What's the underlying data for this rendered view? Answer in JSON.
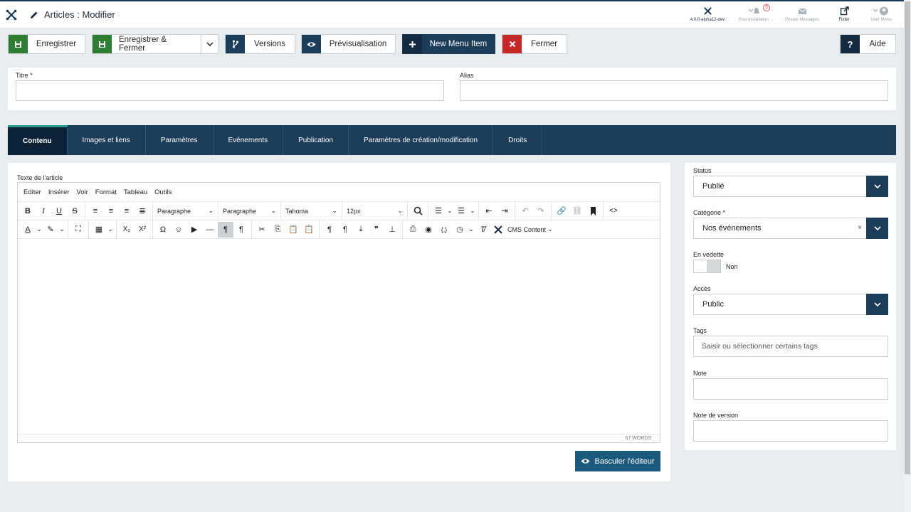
{
  "header": {
    "title": "Articles : Modifier",
    "version": "4.0.0-alpha12-dev",
    "post_installation": "Post Installation ...",
    "post_installation_count": "3",
    "private_messages": "Private Messages",
    "fixter": "Fixter",
    "user_menu": "User Menu"
  },
  "toolbar": {
    "save": "Enregistrer",
    "save_close": "Enregistrer & Fermer",
    "versions": "Versions",
    "preview": "Prévisualisation",
    "new_menu_item": "New Menu Item",
    "close": "Fermer",
    "help": "Aide"
  },
  "form": {
    "title_label": "Titre *",
    "alias_label": "Alias"
  },
  "tabs": [
    "Contenu",
    "Images et liens",
    "Paramètres",
    "Evénements",
    "Publication",
    "Paramètres de création/modification",
    "Droits"
  ],
  "editor": {
    "label": "Texte de l'article",
    "menu": [
      "Editer",
      "Insérer",
      "Voir",
      "Format",
      "Tableau",
      "Outils"
    ],
    "block_format": "Paragraphe",
    "style": "Paragraphe",
    "font": "Tahoma",
    "size": "12px",
    "cms_content": "CMS Content",
    "word_count": "67 WORDS",
    "toggle_button": "Basculer l'éditeur"
  },
  "sidebar": {
    "status_label": "Status",
    "status_value": "Publié",
    "category_label": "Catégorie *",
    "category_value": "Nos événements",
    "featured_label": "En vedette",
    "featured_value": "Non",
    "access_label": "Accès",
    "access_value": "Public",
    "tags_label": "Tags",
    "tags_placeholder": "Saisir ou sélectionner certains tags",
    "note_label": "Note",
    "version_note_label": "Note de version"
  },
  "colors": {
    "primary": "#1c3d5a",
    "save": "#2f7d32",
    "close": "#c52827",
    "accent": "#2a9d8f"
  }
}
